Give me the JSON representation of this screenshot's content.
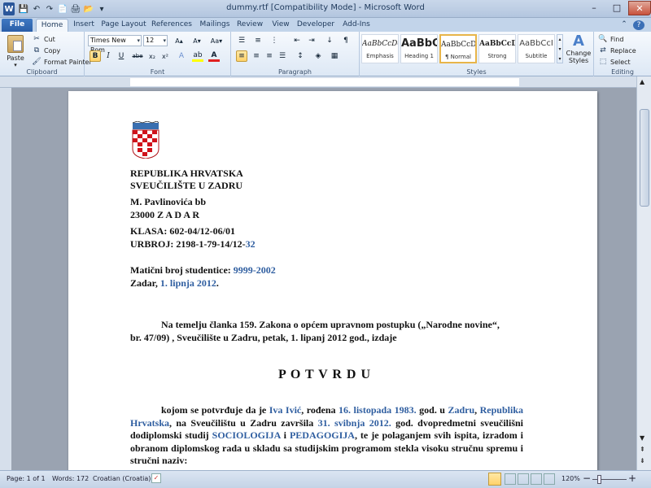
{
  "window": {
    "title": "dummy.rtf [Compatibility Mode] - Microsoft Word",
    "minimize": "–",
    "maximize": "□",
    "close": "✕"
  },
  "quick_access": [
    "W",
    "💾",
    "↶",
    "↷",
    "📄",
    "🖨",
    "📂",
    "▾"
  ],
  "tabs": [
    "File",
    "Home",
    "Insert",
    "Page Layout",
    "References",
    "Mailings",
    "Review",
    "View",
    "Developer",
    "Add-Ins"
  ],
  "ribbon": {
    "clipboard": {
      "label": "Clipboard",
      "paste": "Paste",
      "cut": "Cut",
      "copy": "Copy",
      "format_painter": "Format Painter"
    },
    "font": {
      "label": "Font",
      "font_name": "Times New Rom",
      "font_size": "12",
      "bold": "B",
      "italic": "I",
      "underline": "U",
      "strike": "abe",
      "subscript": "x₂",
      "superscript": "x²"
    },
    "paragraph": {
      "label": "Paragraph"
    },
    "styles": {
      "label": "Styles",
      "cards": [
        {
          "preview": "AaBbCcDc",
          "name": "Emphasis"
        },
        {
          "preview": "AaBbC",
          "name": "Heading 1"
        },
        {
          "preview": "AaBbCcDc",
          "name": "¶ Normal"
        },
        {
          "preview": "AaBbCcDd",
          "name": "Strong"
        },
        {
          "preview": "AaBbCcI",
          "name": "Subtitle"
        }
      ],
      "change_styles": "Change Styles"
    },
    "editing": {
      "label": "Editing",
      "find": "Find",
      "replace": "Replace",
      "select": "Select"
    }
  },
  "document": {
    "line1": "REPUBLIKA HRVATSKA",
    "line2": "SVEUČILIŠTE U ZADRU",
    "line3": "M. Pavlinovića bb",
    "line4": "23000  Z A D A R",
    "klasa": "KLASA: 602-04/12-06/01",
    "urbroj_prefix": "URBROJ: 2198-1-79-14/12-",
    "urbroj_suffix": "32",
    "maticni_label": "Matični broj studentice: ",
    "maticni_value": "9999-2002",
    "zadar_prefix": "Zadar, ",
    "zadar_date": "1. lipnja 2012",
    "zadar_suffix": ".",
    "para1_line1": "Na temelju  članka 159. Zakona o općem upravnom postupku („Narodne novine“,",
    "para1_line2": "br. 47/09) , Sveučilište u Zadru, petak, 1. lipanj 2012 god., izdaje",
    "heading": "P O T V R D U",
    "para2": {
      "t1": "kojom se potvrđuje da je ",
      "name": "Iva Ivić",
      "t2": ", rođena ",
      "dob": "16. listopada 1983.",
      "t3": " god. u ",
      "city": "Zadru",
      "t4": ", ",
      "country": "Republika Hrvatska",
      "t5": ", na Sveučilištu u Zadru završila ",
      "grad_date": "31. svibnja 2012.",
      "t6": " god. dvopredmetni sveučilišni dodiplomski studij ",
      "subj1": "SOCIOLOGIJA",
      "t7": " i ",
      "subj2": "PEDAGOGIJA",
      "t8": ", te je polaganjem svih ispita, izradom i obranom diplomskog rada u skladu sa studijskim programom stekla visoku stručnu spremu i stručni naziv:"
    }
  },
  "status": {
    "page": "Page: 1 of 1",
    "words": "Words: 172",
    "language": "Croatian (Croatia)",
    "zoom": "120%"
  },
  "colors": {
    "accent": "#2b579a",
    "field_blue": "#2f5ea0"
  }
}
